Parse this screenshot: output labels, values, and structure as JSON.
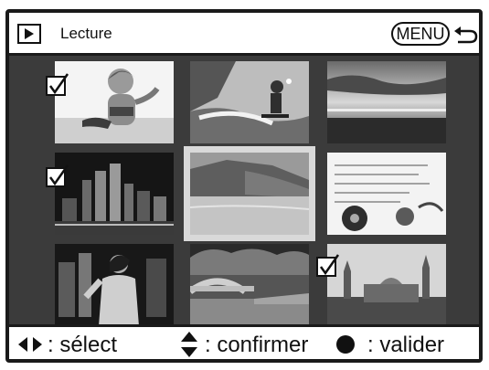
{
  "header": {
    "title": "Lecture",
    "menu_label": "MENU"
  },
  "icons": {
    "mode": "play-icon",
    "back": "back-arrow-icon",
    "check": "checkmark-icon"
  },
  "thumbnails": [
    {
      "subject": "girl-beach",
      "checked": true
    },
    {
      "subject": "water-skier",
      "checked": false
    },
    {
      "subject": "seascape",
      "checked": false
    },
    {
      "subject": "city-night",
      "checked": true
    },
    {
      "subject": "coast-cliffs",
      "checked": false,
      "selected": true
    },
    {
      "subject": "flower-letter",
      "checked": false
    },
    {
      "subject": "woman-city",
      "checked": false
    },
    {
      "subject": "bridge-park",
      "checked": false
    },
    {
      "subject": "palace",
      "checked": true
    }
  ],
  "footer": {
    "select_label": ": sélect",
    "confirm_label": ": confirmer",
    "validate_label": ": valider"
  },
  "colors": {
    "background": "#3a3a3a",
    "bar": "#ffffff",
    "selection": "#d9d9d9"
  }
}
